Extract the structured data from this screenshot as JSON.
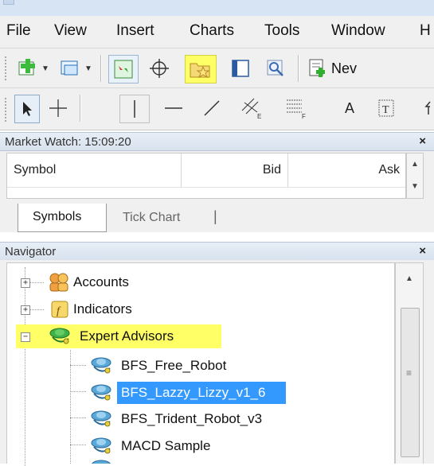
{
  "menu": [
    "File",
    "View",
    "Insert",
    "Charts",
    "Tools",
    "Window",
    "H"
  ],
  "toolbar1": {
    "new_order_label": "Nev"
  },
  "toolbar2": {
    "text_tool": "A"
  },
  "market_watch": {
    "title": "Market Watch: 15:09:20",
    "columns": [
      "Symbol",
      "Bid",
      "Ask"
    ],
    "tabs": [
      "Symbols",
      "Tick Chart"
    ]
  },
  "navigator": {
    "title": "Navigator",
    "nodes": [
      {
        "label": "Accounts",
        "icon": "accounts-icon",
        "expander": "+"
      },
      {
        "label": "Indicators",
        "icon": "indicators-icon",
        "expander": "+"
      },
      {
        "label": "Expert Advisors",
        "icon": "expert-advisors-icon",
        "expander": "−",
        "highlighted": true
      }
    ],
    "experts": [
      {
        "label": "BFS_Free_Robot"
      },
      {
        "label": "BFS_Lazzy_Lizzy_v1_6",
        "selected": true
      },
      {
        "label": "BFS_Trident_Robot_v3"
      },
      {
        "label": "MACD Sample"
      }
    ]
  },
  "colors": {
    "highlight": "#ffff66",
    "selection": "#3399ff",
    "panel_header": "#dbe5f1"
  }
}
